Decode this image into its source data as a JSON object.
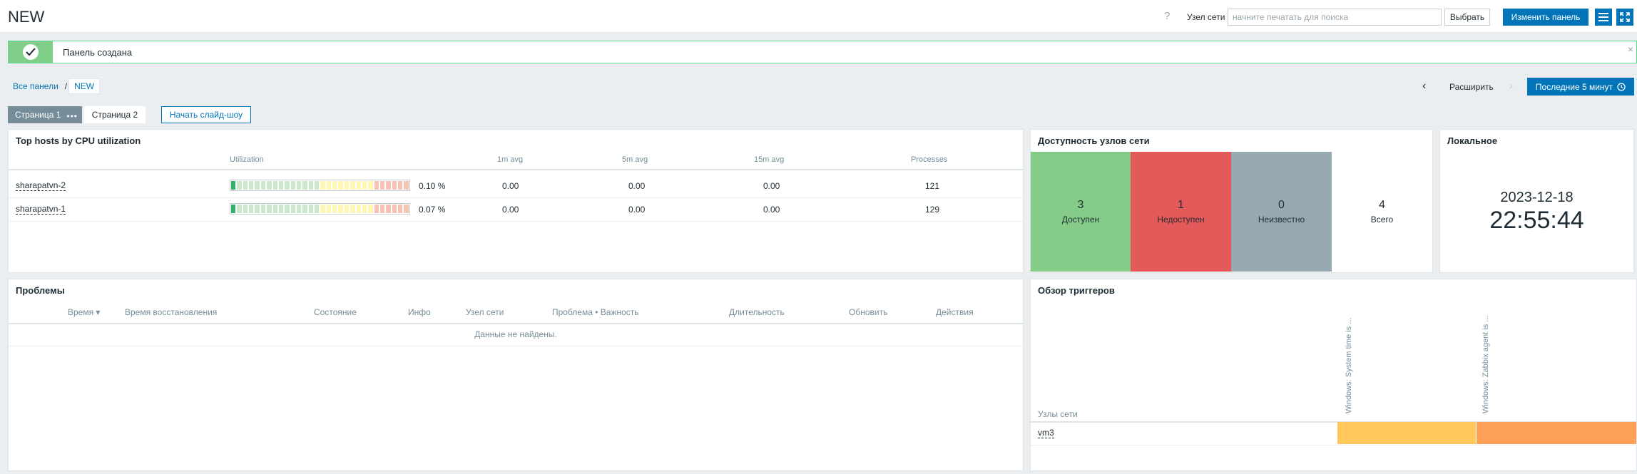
{
  "header": {
    "title": "NEW",
    "host_label": "Узел сети",
    "host_placeholder": "начните печатать для поиска",
    "select_label": "Выбрать",
    "edit_label": "Изменить панель"
  },
  "message": {
    "text": "Панель создана"
  },
  "breadcrumb": {
    "all": "Все панели",
    "separator": "/",
    "current": "NEW"
  },
  "time_nav": {
    "expand_label": "Расширить",
    "period_label": "Последние 5 минут"
  },
  "pages": {
    "page1": "Страница 1",
    "page2": "Страница 2",
    "slideshow_label": "Начать слайд-шоу"
  },
  "top_hosts": {
    "title": "Top hosts by CPU utilization",
    "columns": {
      "utilization": "Utilization",
      "avg1": "1m avg",
      "avg5": "5m avg",
      "avg15": "15m avg",
      "processes": "Processes"
    },
    "rows": [
      {
        "host": "sharapatvn-2",
        "util": "0.10 %",
        "util_value": 0.1,
        "avg1": "0.00",
        "avg5": "0.00",
        "avg15": "0.00",
        "processes": "121"
      },
      {
        "host": "sharapatvn-1",
        "util": "0.07 %",
        "util_value": 0.07,
        "avg1": "0.00",
        "avg5": "0.00",
        "avg15": "0.00",
        "processes": "129"
      }
    ]
  },
  "availability": {
    "title": "Доступность узлов сети",
    "available": {
      "count": "3",
      "label": "Доступен",
      "color": "#86cc89"
    },
    "unavailable": {
      "count": "1",
      "label": "Недоступен",
      "color": "#e45959"
    },
    "unknown": {
      "count": "0",
      "label": "Неизвестно",
      "color": "#97aab3"
    },
    "total": {
      "count": "4",
      "label": "Всего"
    }
  },
  "clock": {
    "title": "Локальное",
    "date": "2023-12-18",
    "time": "22:55:44"
  },
  "problems": {
    "title": "Проблемы",
    "columns": {
      "time": "Время ▾",
      "recovery": "Время восстановления",
      "status": "Состояние",
      "info": "Инфо",
      "host": "Узел сети",
      "problem": "Проблема • Важность",
      "duration": "Длительность",
      "update": "Обновить",
      "actions": "Действия"
    },
    "empty": "Данные не найдены."
  },
  "trigger_overview": {
    "title": "Обзор триггеров",
    "hosts_label": "Узлы сети",
    "triggers": [
      "Windows: System time is ...",
      "Windows: Zabbix agent is ..."
    ],
    "host": "vm3",
    "cell_colors": [
      "#ffc859",
      "#ffa059"
    ]
  }
}
